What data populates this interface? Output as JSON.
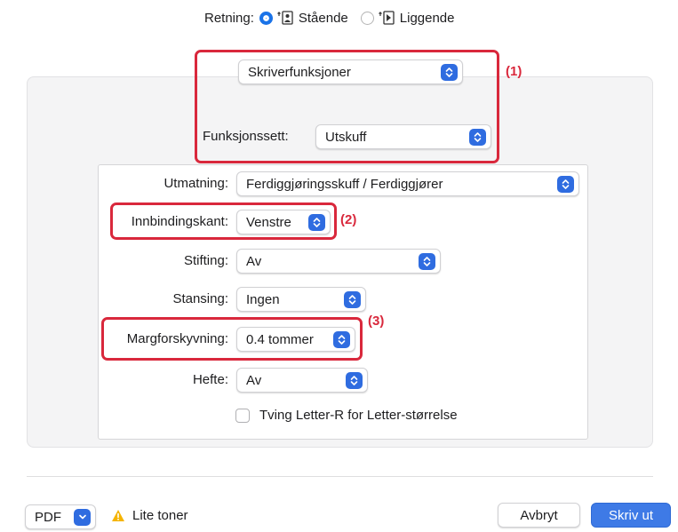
{
  "orientation": {
    "label": "Retning:",
    "options": [
      {
        "label": "Stående",
        "selected": true,
        "icon": "portrait-orientation-icon"
      },
      {
        "label": "Liggende",
        "selected": false,
        "icon": "landscape-orientation-icon"
      }
    ]
  },
  "top_section": {
    "panel_select": "Skriverfunksjoner",
    "feature_set_label": "Funksjonssett:",
    "feature_set_value": "Utskuff"
  },
  "fields": [
    {
      "label": "Utmatning:",
      "value": "Ferdiggjøringsskuff / Ferdiggjører"
    },
    {
      "label": "Innbindingskant:",
      "value": "Venstre"
    },
    {
      "label": "Stifting:",
      "value": "Av"
    },
    {
      "label": "Stansing:",
      "value": "Ingen"
    },
    {
      "label": "Margforskyvning:",
      "value": "0.4 tommer"
    },
    {
      "label": "Hefte:",
      "value": "Av"
    }
  ],
  "checkbox": {
    "label": "Tving Letter-R for Letter-størrelse",
    "checked": false
  },
  "callouts": [
    "(1)",
    "(2)",
    "(3)"
  ],
  "bottom": {
    "pdf_label": "PDF",
    "warning_text": "Lite toner",
    "cancel_label": "Avbryt",
    "print_label": "Skriv ut"
  },
  "colors": {
    "accent": "#2f6ce0",
    "highlight": "#d9283c",
    "warning": "#f5b400"
  }
}
